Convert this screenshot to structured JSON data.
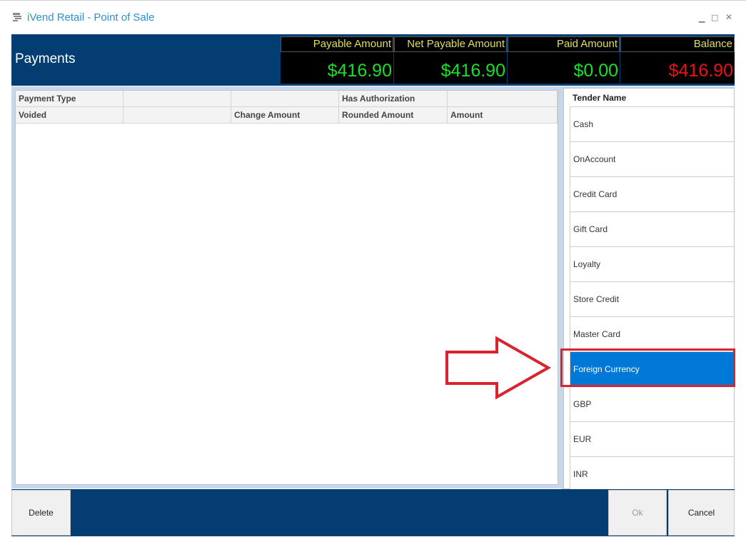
{
  "window": {
    "title": "iVend Retail - Point of Sale"
  },
  "header": {
    "title": "Payments",
    "amounts": [
      {
        "label": "Payable Amount",
        "value": "$416.90"
      },
      {
        "label": "Net Payable Amount",
        "value": "$416.90"
      },
      {
        "label": "Paid Amount",
        "value": "$0.00"
      },
      {
        "label": "Balance",
        "value": "$416.90"
      }
    ]
  },
  "grid": {
    "header_row1": [
      "Payment Type",
      "",
      "",
      "Has Authorization",
      ""
    ],
    "header_row2": [
      "Voided",
      "",
      "Change Amount",
      "Rounded Amount",
      "Amount"
    ]
  },
  "tenders": {
    "header": "Tender Name",
    "items": [
      "Cash",
      "OnAccount",
      "Credit Card",
      "Gift Card",
      "Loyalty",
      "Store Credit",
      "Master Card",
      "Foreign Currency",
      "GBP",
      "EUR",
      "INR"
    ],
    "selected": "Foreign Currency"
  },
  "buttons": {
    "delete": "Delete",
    "ok": "Ok",
    "cancel": "Cancel"
  },
  "colors": {
    "header_bg": "#043d72",
    "positive": "#18e028",
    "negative": "#ee1111",
    "label": "#e3df5a",
    "selected": "#0078d7",
    "annotation": "#d9232e"
  }
}
